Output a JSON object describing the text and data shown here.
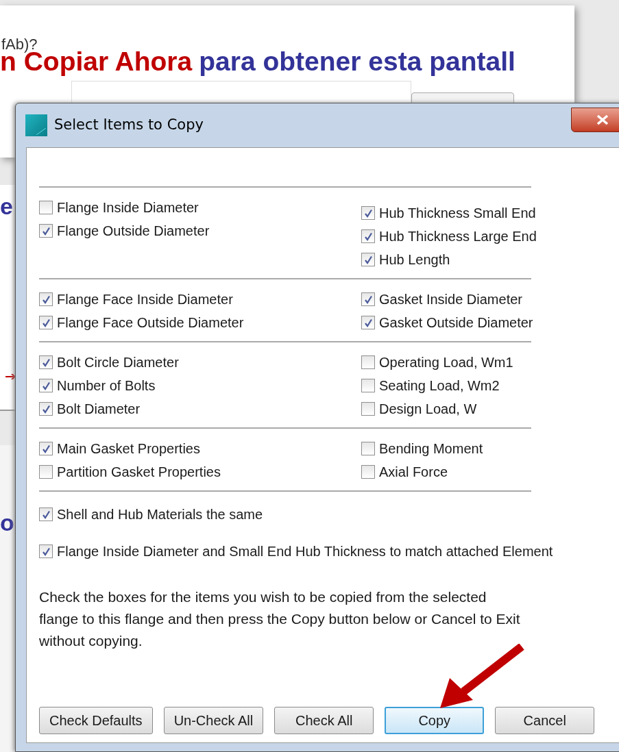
{
  "slide": {
    "fragment": "fAb)?",
    "heading": [
      {
        "text": "n Copiar Ahora",
        "color": "#c00000"
      },
      {
        "text": "para obtener esta pantall",
        "color": "#333399"
      }
    ],
    "side_fragments": [
      "e",
      "o"
    ]
  },
  "dialog": {
    "title": "Select Items to Copy",
    "sections": [
      {
        "left": [
          {
            "label": "Flange Inside Diameter",
            "checked": false
          },
          {
            "label": "Flange Outside Diameter",
            "checked": true
          }
        ],
        "right": [
          {
            "label": "Hub Thickness Small End",
            "checked": true
          },
          {
            "label": "Hub Thickness Large End",
            "checked": true
          },
          {
            "label": "Hub Length",
            "checked": true
          }
        ]
      },
      {
        "left": [
          {
            "label": "Flange Face Inside Diameter",
            "checked": true
          },
          {
            "label": "Flange Face Outside Diameter",
            "checked": true
          }
        ],
        "right": [
          {
            "label": "Gasket Inside Diameter",
            "checked": true
          },
          {
            "label": "Gasket Outside Diameter",
            "checked": true
          }
        ]
      },
      {
        "left": [
          {
            "label": "Bolt Circle Diameter",
            "checked": true
          },
          {
            "label": "Number of Bolts",
            "checked": true
          },
          {
            "label": "Bolt Diameter",
            "checked": true
          }
        ],
        "right": [
          {
            "label": "Operating Load, Wm1",
            "checked": false
          },
          {
            "label": "Seating Load, Wm2",
            "checked": false
          },
          {
            "label": "Design Load, W",
            "checked": false
          }
        ]
      },
      {
        "left": [
          {
            "label": "Main Gasket Properties",
            "checked": true
          },
          {
            "label": "Partition Gasket Properties",
            "checked": false
          }
        ],
        "right": [
          {
            "label": "Bending Moment",
            "checked": false
          },
          {
            "label": "Axial Force",
            "checked": false
          }
        ]
      }
    ],
    "options": [
      {
        "label": "Shell and Hub Materials the same",
        "checked": true
      },
      {
        "label": "Flange Inside Diameter and Small End Hub Thickness to match attached Element",
        "checked": true
      }
    ],
    "instructions": "Check the boxes for the items you wish to be copied from the selected flange to this flange and then press the Copy button below or Cancel to Exit without copying.",
    "buttons": [
      {
        "label": "Check Defaults",
        "selected": false
      },
      {
        "label": "Un-Check All",
        "selected": false
      },
      {
        "label": "Check All",
        "selected": false
      },
      {
        "label": "Copy",
        "selected": true
      },
      {
        "label": "Cancel",
        "selected": false
      }
    ]
  }
}
